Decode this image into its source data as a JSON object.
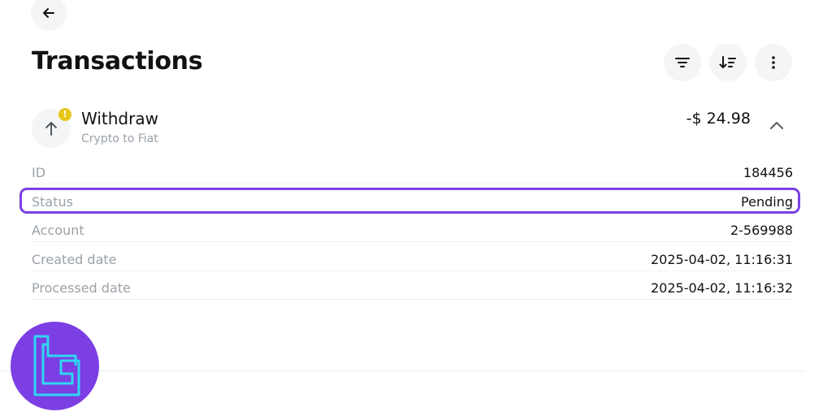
{
  "header": {
    "title": "Transactions",
    "back_icon": "arrow-left-icon",
    "filter_icon": "filter-icon",
    "sort_icon": "sort-icon",
    "more_icon": "more-vertical-icon"
  },
  "transaction": {
    "type": "Withdraw",
    "subtype": "Crypto to Fiat",
    "amount": "-$ 24.98",
    "badge_symbol": "!",
    "icon": "arrow-up-icon",
    "expand_icon": "chevron-up-icon",
    "details": [
      {
        "label": "ID",
        "value": "184456"
      },
      {
        "label": "Status",
        "value": "Pending"
      },
      {
        "label": "Account",
        "value": "2-569988"
      },
      {
        "label": "Created date",
        "value": "2025-04-02, 11:16:31"
      },
      {
        "label": "Processed date",
        "value": "2025-04-02, 11:16:32"
      }
    ]
  },
  "colors": {
    "accent": "#7b3fe4",
    "warning": "#e6c619",
    "muted_text": "#9aa1a8",
    "logo_stroke": "#2fd6f0"
  }
}
